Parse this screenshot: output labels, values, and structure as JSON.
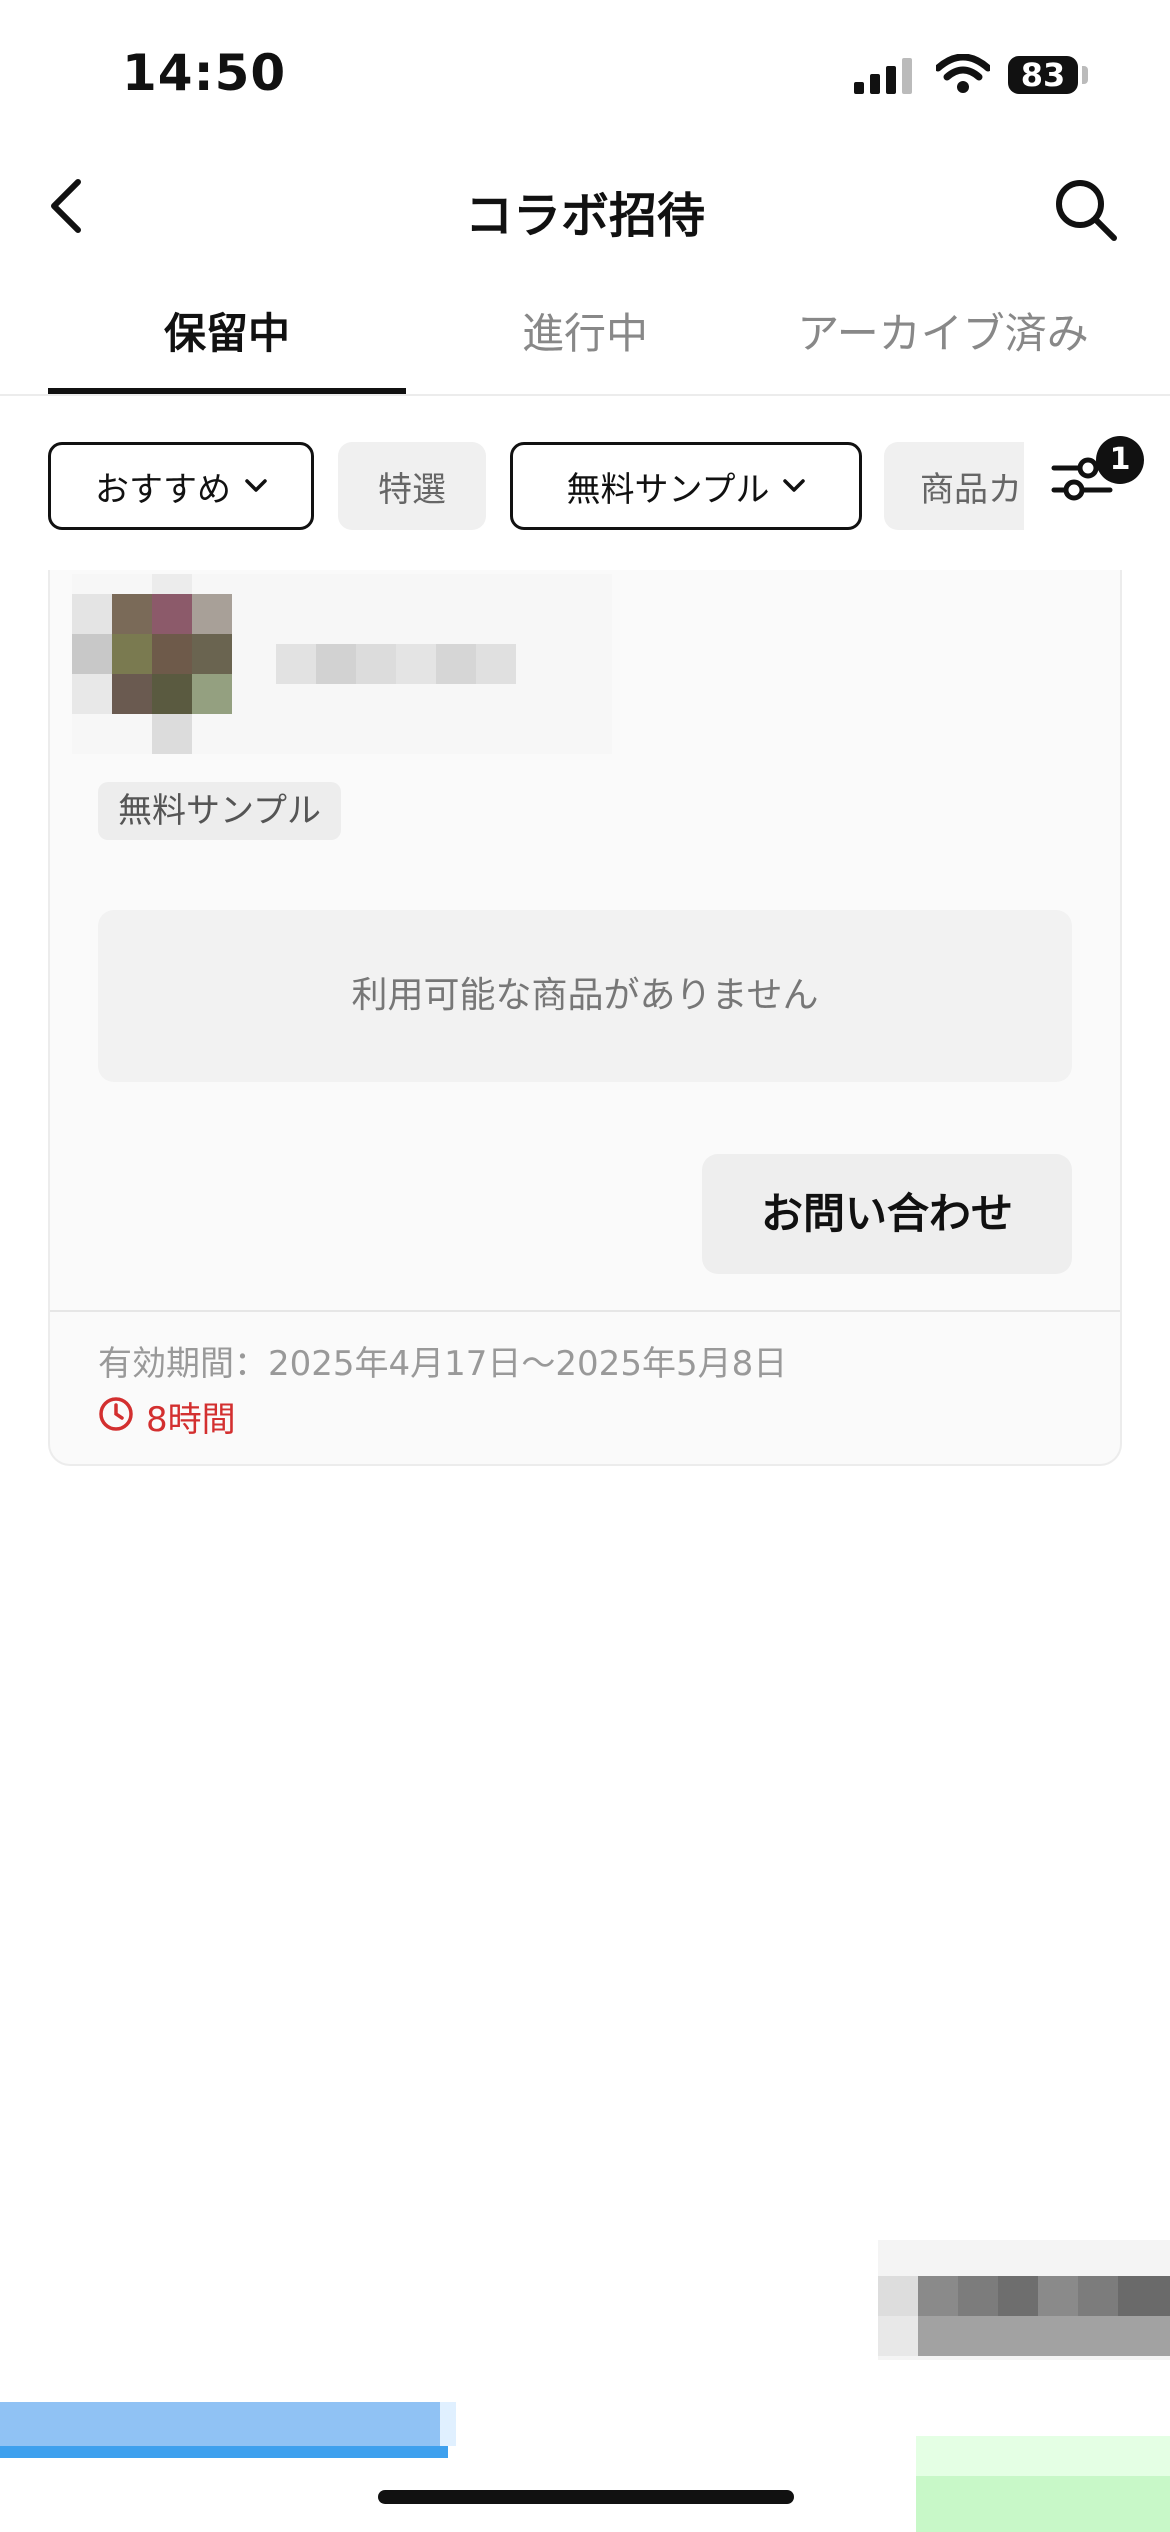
{
  "status_bar": {
    "time": "14:50",
    "battery": "83"
  },
  "header": {
    "title": "コラボ招待"
  },
  "tabs": [
    {
      "label": "保留中",
      "active": true
    },
    {
      "label": "進行中",
      "active": false
    },
    {
      "label": "アーカイブ済み",
      "active": false
    }
  ],
  "filters": {
    "chips": [
      {
        "label": "おすすめ",
        "dropdown": true
      },
      {
        "label": "特選",
        "dropdown": false
      },
      {
        "label": "無料サンプル",
        "dropdown": true
      },
      {
        "label": "商品カ",
        "dropdown": false
      }
    ],
    "badge_count": "1"
  },
  "card": {
    "tag": "無料サンプル",
    "notice": "利用可能な商品がありません",
    "contact_button": "お問い合わせ",
    "validity": "有効期間：2025年4月17日～2025年5月8日",
    "remaining": "8時間"
  },
  "colors": {
    "accent": "#111111",
    "countdown": "#d32f2f",
    "muted_text": "#999999"
  }
}
